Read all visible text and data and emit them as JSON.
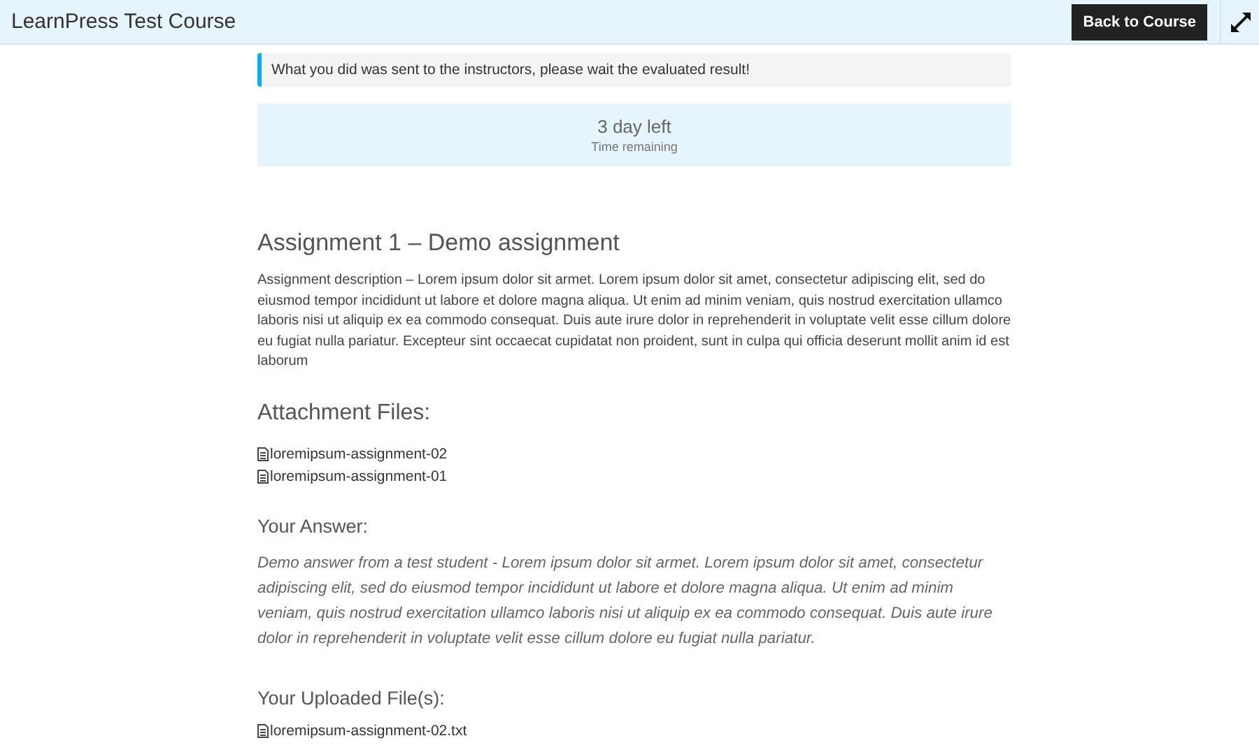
{
  "header": {
    "title": "LearnPress Test Course",
    "back_button": "Back to Course"
  },
  "notice": "What you did was sent to the instructors, please wait the evaluated result!",
  "timer": {
    "value": "3 day left",
    "label": "Time remaining"
  },
  "assignment": {
    "title": "Assignment 1 – Demo assignment",
    "description": "Assignment description – Lorem ipsum dolor sit armet. Lorem ipsum dolor sit amet, consectetur adipiscing elit, sed do eiusmod tempor incididunt ut labore et dolore magna aliqua. Ut enim ad minim veniam, quis nostrud exercitation ullamco laboris nisi ut aliquip ex ea commodo consequat. Duis aute irure dolor in reprehenderit in voluptate velit esse cillum dolore eu fugiat nulla pariatur. Excepteur sint occaecat cupidatat non proident, sunt in culpa qui officia deserunt mollit anim id est laborum"
  },
  "attachments": {
    "heading": "Attachment Files:",
    "files": [
      "loremipsum-assignment-02",
      "loremipsum-assignment-01"
    ]
  },
  "answer": {
    "heading": "Your Answer:",
    "text": "Demo answer from a test student - Lorem ipsum dolor sit armet. Lorem ipsum dolor sit amet, consectetur adipiscing elit, sed do eiusmod tempor incididunt ut labore et dolore magna aliqua. Ut enim ad minim veniam, quis nostrud exercitation ullamco laboris nisi ut aliquip ex ea commodo consequat. Duis aute irure dolor in reprehenderit in voluptate velit esse cillum dolore eu fugiat nulla pariatur."
  },
  "uploads": {
    "heading": "Your Uploaded File(s):",
    "files": [
      "loremipsum-assignment-02.txt"
    ]
  }
}
